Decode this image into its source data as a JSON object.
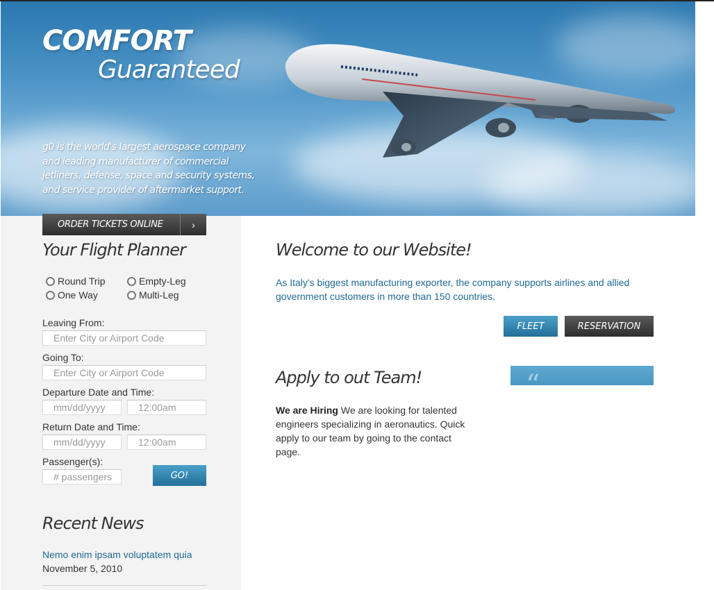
{
  "banner": {
    "title_line1": "COMFORT",
    "title_line2": "Guaranteed",
    "description": "g0 is the world's largest aerospace company and leading manufacturer of commercial jetliners, defense, space and security systems, and service provider of aftermarket support."
  },
  "sidebar": {
    "order_button_label": "ORDER TICKETS ONLINE",
    "planner_title": "Your Flight Planner",
    "trip_types": [
      "Round Trip",
      "Empty-Leg",
      "One Way",
      "Multi-Leg"
    ],
    "leaving_label": "Leaving From:",
    "leaving_placeholder": "Enter City or Airport Code",
    "going_label": "Going To:",
    "going_placeholder": "Enter City or Airport Code",
    "departure_label": "Departure Date and Time:",
    "departure_date_placeholder": "mm/dd/yyyy",
    "departure_time_placeholder": "12:00am",
    "return_label": "Return Date and Time:",
    "return_date_placeholder": "mm/dd/yyyy",
    "return_time_placeholder": "12:00am",
    "passengers_label": "Passenger(s):",
    "passengers_placeholder": "# passengers",
    "go_button_label": "GO!",
    "news_title": "Recent News",
    "news": [
      {
        "title": "Nemo enim ipsam voluptatem quia",
        "date": "November 5, 2010"
      }
    ]
  },
  "main": {
    "welcome_title": "Welcome to our Website!",
    "welcome_text": "As Italy's biggest manufacturing exporter, the company supports airlines and allied government customers in more than 150 countries.",
    "fleet_button_label": "FLEET",
    "reservation_button_label": "RESERVATION",
    "apply_title": "Apply to out Team!",
    "apply_bold": "We are Hiring",
    "apply_text": " We are looking for talented engineers specializing in aeronautics. Quick apply to our team by going to the contact page.",
    "quote_mark": "“"
  },
  "colors": {
    "accent_blue": "#236f9a",
    "link_blue": "#1e6a96",
    "dark_button": "#2e2e2e",
    "sidebar_bg": "#f3f3f3"
  }
}
